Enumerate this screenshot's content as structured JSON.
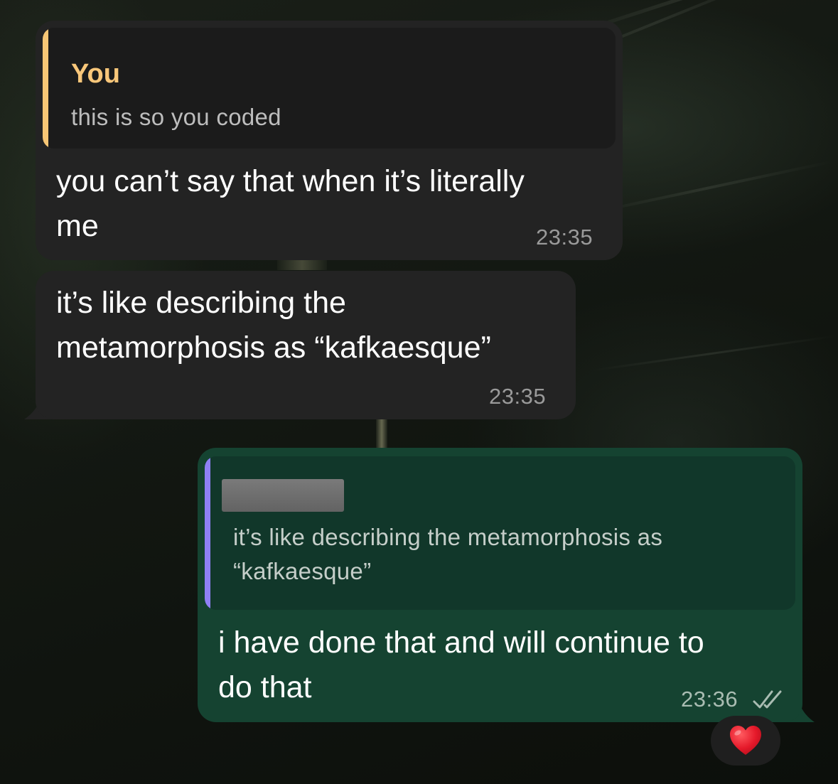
{
  "messages": [
    {
      "reply": {
        "author": "You",
        "text": "this is so you coded"
      },
      "lines": [
        "you can’t say that when it’s literally",
        "me"
      ],
      "time": "23:35"
    },
    {
      "lines": [
        "it’s like describing the",
        "metamorphosis as “kafkaesque”"
      ],
      "time": "23:35"
    },
    {
      "reply": {
        "author": "",
        "text_lines": [
          "it’s like describing the metamorphosis as",
          "“kafkaesque”"
        ]
      },
      "lines": [
        "i have done that and will continue to",
        "do that"
      ],
      "time": "23:36",
      "status": "read-double-check-icon",
      "reaction": "heart"
    }
  ],
  "colors": {
    "incoming_bubble": "#232323",
    "outgoing_bubble": "#154331",
    "reply_bar_you": "#f7c675",
    "reply_bar_other": "#8f80f5",
    "reaction_heart": "#e5192a"
  }
}
